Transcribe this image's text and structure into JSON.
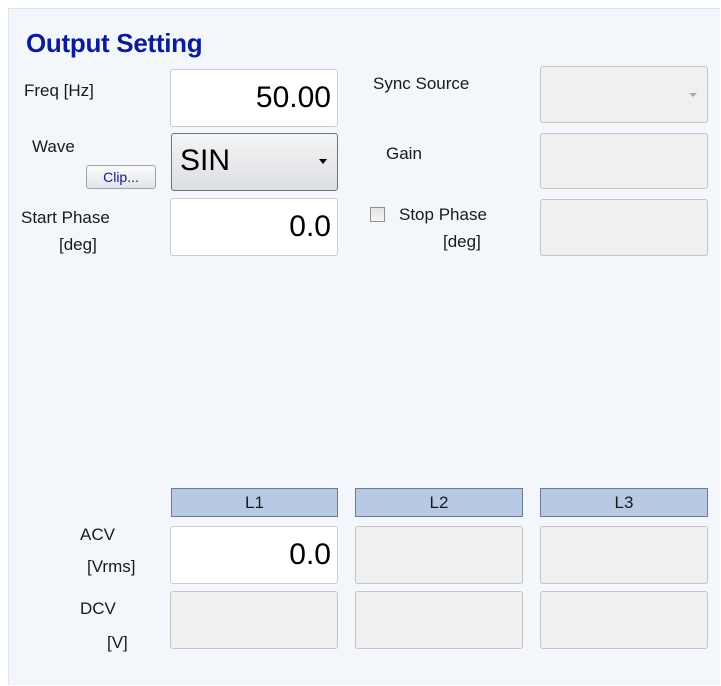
{
  "title": "Output Setting",
  "freq": {
    "label": "Freq [Hz]",
    "value": "50.00"
  },
  "wave": {
    "label": "Wave",
    "clip_label": "Clip...",
    "selected": "SIN"
  },
  "start_phase": {
    "label_line1": "Start Phase",
    "label_line2": "[deg]",
    "value": "0.0"
  },
  "sync_source": {
    "label": "Sync Source"
  },
  "gain": {
    "label": "Gain"
  },
  "stop_phase": {
    "label_line1": "Stop Phase",
    "label_line2": "[deg]",
    "checked": false
  },
  "columns": [
    "L1",
    "L2",
    "L3"
  ],
  "acv": {
    "label_line1": "ACV",
    "label_line2": "[Vrms]",
    "l1_value": "0.0"
  },
  "dcv": {
    "label_line1": "DCV",
    "label_line2": "[V]"
  }
}
